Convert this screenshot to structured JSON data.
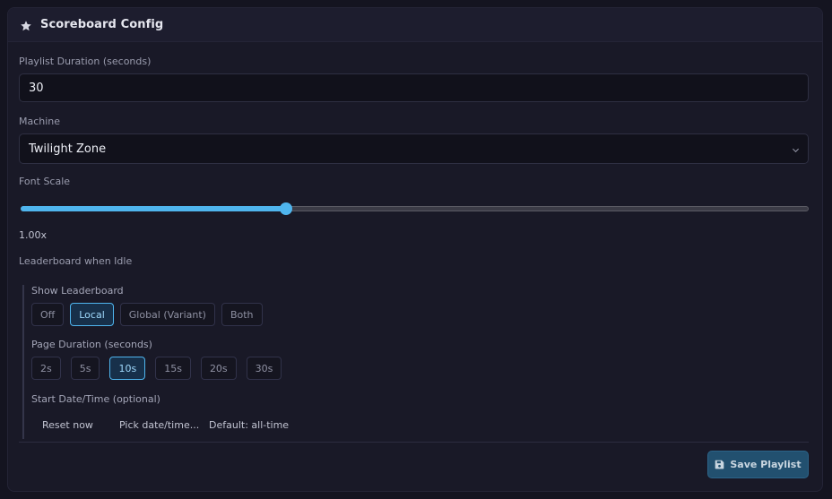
{
  "panel": {
    "title": "Scoreboard Config",
    "icon": "star-icon"
  },
  "playlist_duration": {
    "label": "Playlist Duration (seconds)",
    "value": "30"
  },
  "machine": {
    "label": "Machine",
    "value": "Twilight Zone"
  },
  "font_scale": {
    "label": "Font Scale",
    "value_text": "1.00x",
    "fill_fraction": 0.337
  },
  "leaderboard": {
    "section_label": "Leaderboard when Idle",
    "show": {
      "label": "Show Leaderboard",
      "options": [
        "Off",
        "Local",
        "Global (Variant)",
        "Both"
      ],
      "selected": "Local"
    },
    "page_duration": {
      "label": "Page Duration (seconds)",
      "options": [
        "2s",
        "5s",
        "10s",
        "15s",
        "20s",
        "30s"
      ],
      "selected": "10s"
    },
    "start": {
      "label": "Start Date/Time (optional)",
      "reset": "Reset now",
      "pick": "Pick date/time...",
      "default_text": "Default: all-time"
    }
  },
  "save_button": {
    "label": "Save Playlist",
    "icon": "save-icon"
  },
  "colors": {
    "accent": "#4fb5ee",
    "panel_bg": "#191927",
    "page_bg": "#141420"
  }
}
